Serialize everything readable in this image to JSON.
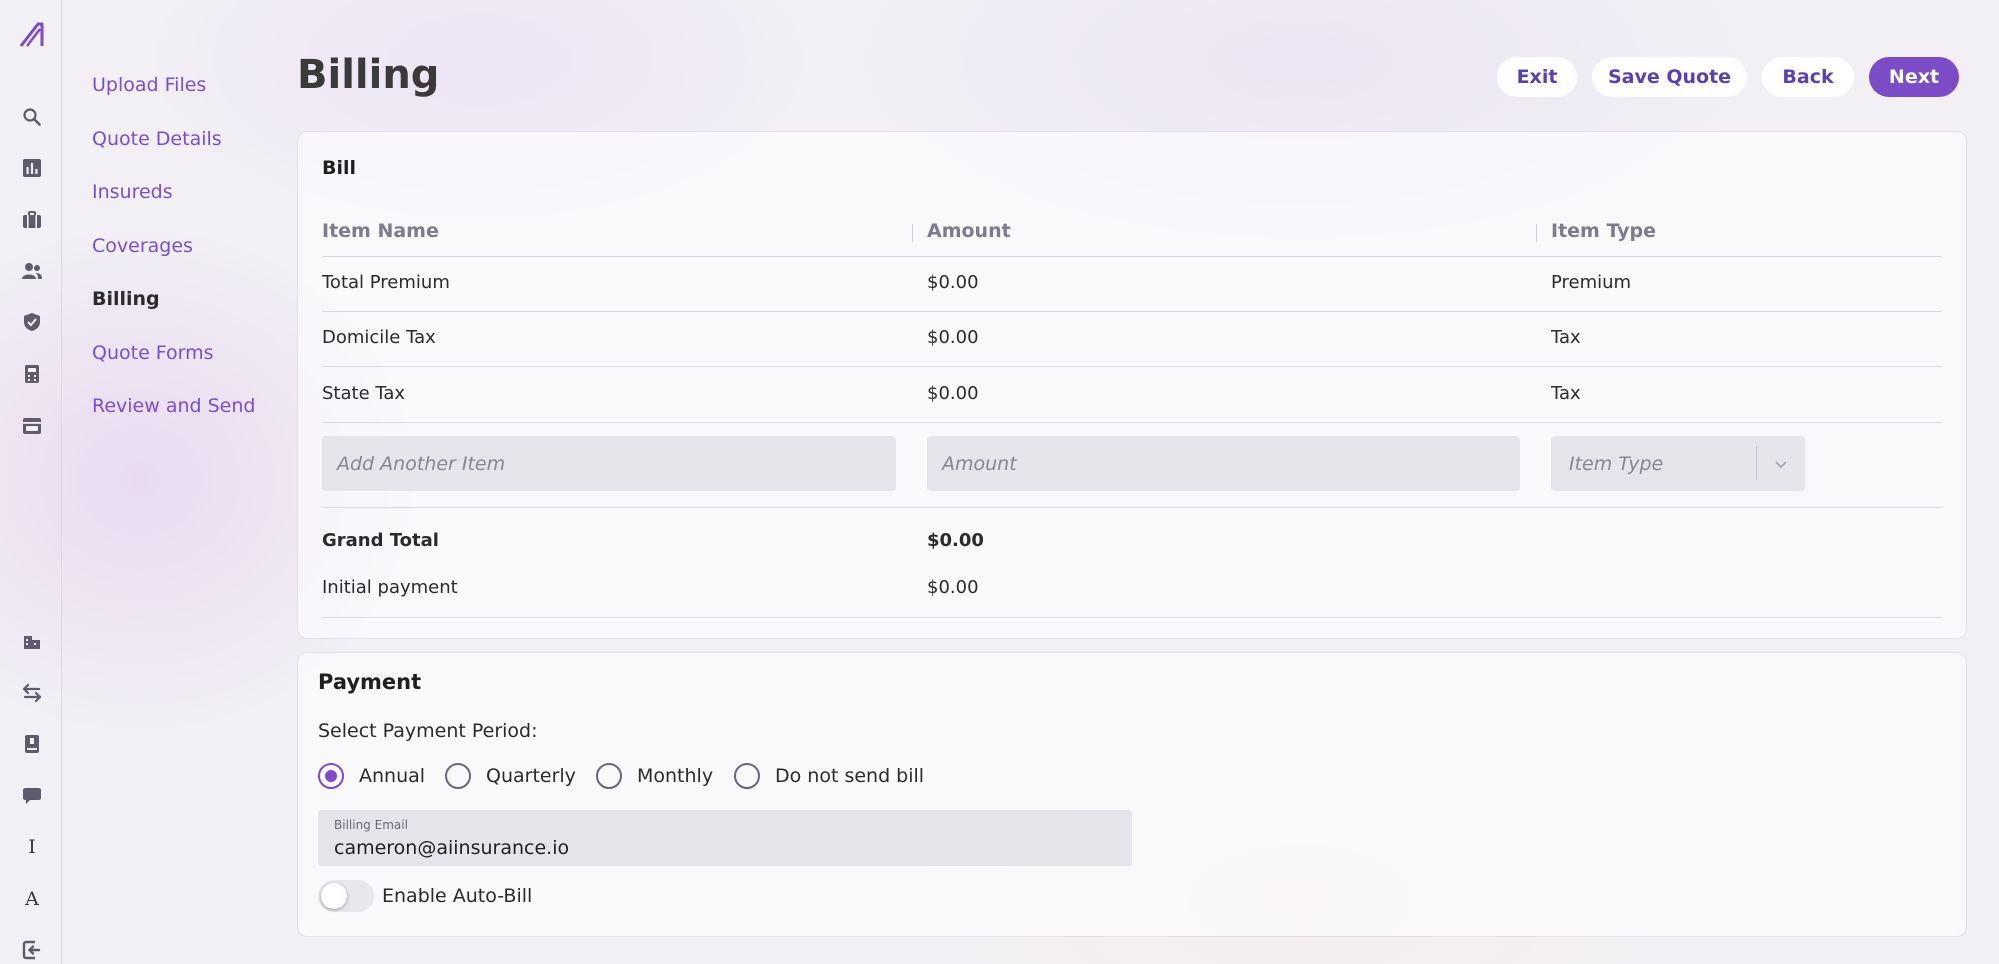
{
  "nav_rail": {
    "top_icons": [
      "search-icon",
      "bar-chart-icon",
      "briefcase-icon",
      "users-icon",
      "shield-check-icon",
      "calculator-icon",
      "archive-icon"
    ],
    "bottom_icons": [
      "building-icon",
      "transfer-icon",
      "book-icon",
      "chat-icon",
      "text-cursor-icon",
      "font-icon",
      "logout-icon"
    ],
    "bottom_glyphs": {
      "text": "I",
      "font": "A"
    },
    "accent": "#7b4cc5"
  },
  "subnav": {
    "items": [
      {
        "label": "Upload Files",
        "active": false
      },
      {
        "label": "Quote Details",
        "active": false
      },
      {
        "label": "Insureds",
        "active": false
      },
      {
        "label": "Coverages",
        "active": false
      },
      {
        "label": "Billing",
        "active": true
      },
      {
        "label": "Quote Forms",
        "active": false
      },
      {
        "label": "Review and Send",
        "active": false
      }
    ]
  },
  "header": {
    "title": "Billing",
    "buttons": {
      "exit": "Exit",
      "save_quote": "Save Quote",
      "back": "Back",
      "next": "Next"
    }
  },
  "bill": {
    "title": "Bill",
    "columns": [
      "Item Name",
      "Amount",
      "Item Type"
    ],
    "rows": [
      {
        "name": "Total Premium",
        "amount": "$0.00",
        "type": "Premium"
      },
      {
        "name": "Domicile Tax",
        "amount": "$0.00",
        "type": "Tax"
      },
      {
        "name": "State Tax",
        "amount": "$0.00",
        "type": "Tax"
      }
    ],
    "add_item": {
      "name_placeholder": "Add Another Item",
      "amount_placeholder": "Amount",
      "type_placeholder": "Item Type"
    },
    "grand_total": {
      "label": "Grand Total",
      "value": "$0.00"
    },
    "initial_payment": {
      "label": "Initial payment",
      "value": "$0.00"
    }
  },
  "payment": {
    "title": "Payment",
    "period_label": "Select Payment Period:",
    "options": [
      {
        "label": "Annual",
        "checked": true
      },
      {
        "label": "Quarterly",
        "checked": false
      },
      {
        "label": "Monthly",
        "checked": false
      },
      {
        "label": "Do not send bill",
        "checked": false
      }
    ],
    "billing_email": {
      "label": "Billing Email",
      "value": "cameron@aiinsurance.io"
    },
    "auto_bill": {
      "label": "Enable Auto-Bill",
      "enabled": false
    }
  }
}
